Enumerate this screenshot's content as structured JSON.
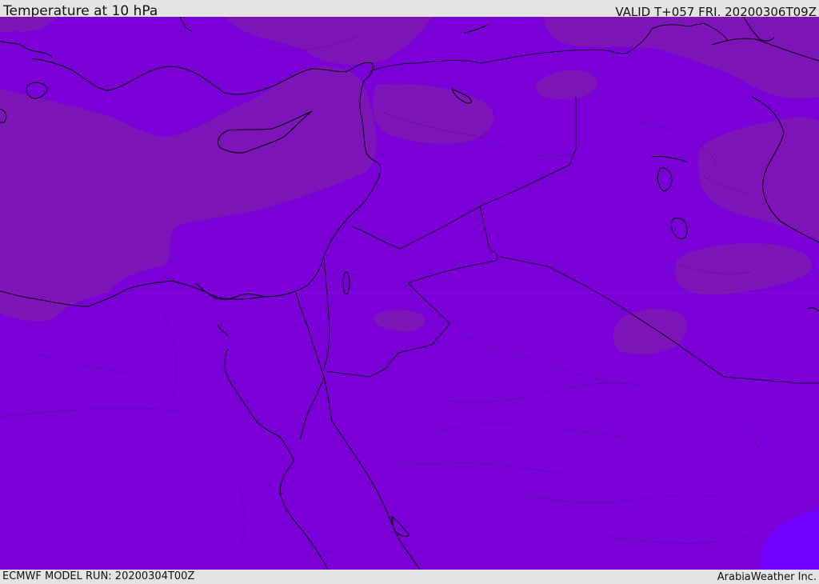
{
  "header": {
    "title": "Temperature at 10 hPa",
    "valid_time": "VALID T+057 FRI. 20200306T09Z"
  },
  "footer": {
    "model_run": "ECMWF MODEL RUN: 20200304T00Z",
    "credit": "ArabiaWeather Inc."
  },
  "map": {
    "colors": {
      "base_field": "#7b00d8",
      "darker_field": "#7c14b8",
      "lighter_field": "#7000ff",
      "coastline": "#000000",
      "header_background": "#e4e4e4"
    },
    "layers": [
      "temperature-field",
      "coastlines",
      "country-borders",
      "admin-boundaries"
    ]
  }
}
